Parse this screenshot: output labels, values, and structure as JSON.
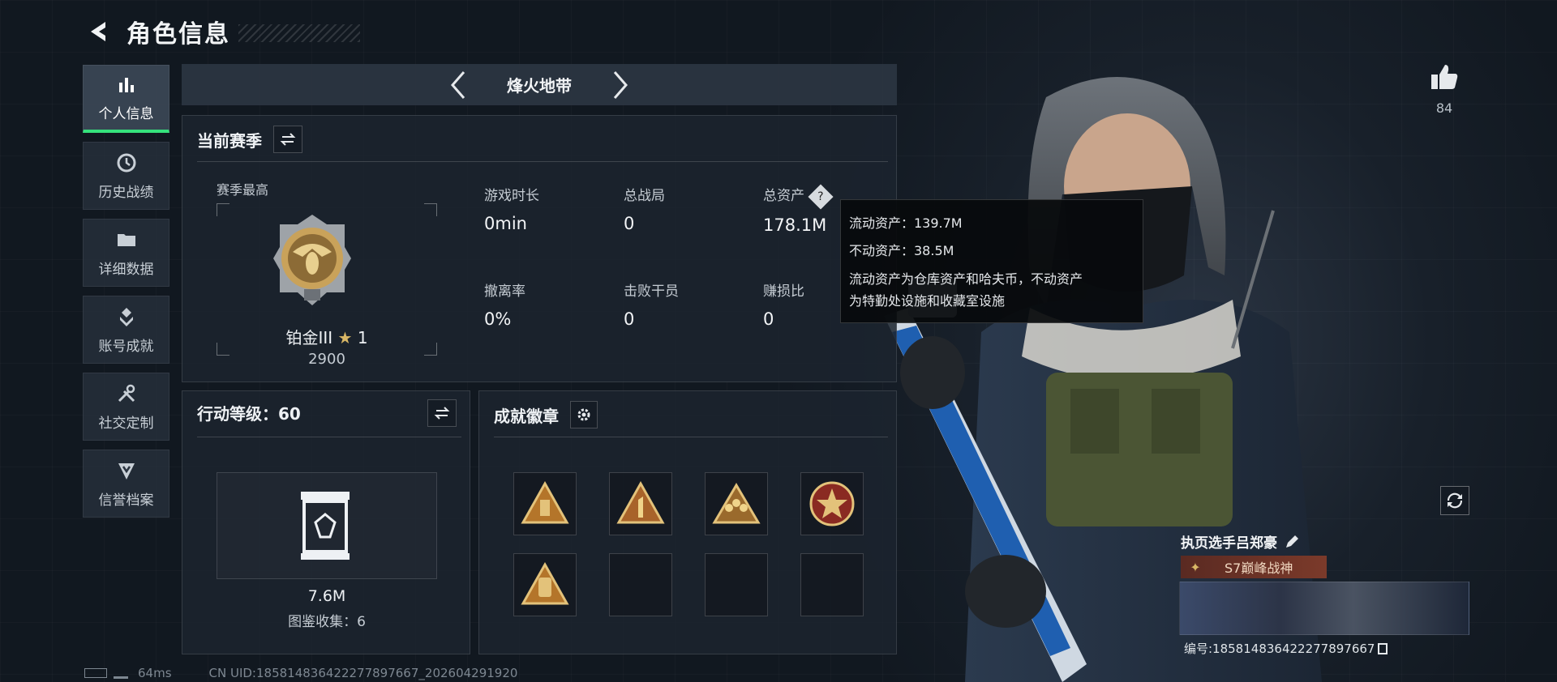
{
  "header": {
    "title": "角色信息"
  },
  "sidebar": {
    "items": [
      {
        "label": "个人信息",
        "icon": "bar-chart-icon",
        "active": true
      },
      {
        "label": "历史战绩",
        "icon": "clock-icon"
      },
      {
        "label": "详细数据",
        "icon": "folder-icon"
      },
      {
        "label": "账号成就",
        "icon": "achievement-icon"
      },
      {
        "label": "社交定制",
        "icon": "tools-icon"
      },
      {
        "label": "信誉档案",
        "icon": "shield-icon"
      }
    ]
  },
  "mode": {
    "title": "烽火地带"
  },
  "season": {
    "title": "当前赛季",
    "best_label": "赛季最高",
    "rank_name": "铂金III",
    "rank_stars": "1",
    "rank_score": "2900",
    "stats": [
      {
        "label": "游戏时长",
        "value": "0min"
      },
      {
        "label": "总战局",
        "value": "0"
      },
      {
        "label": "总资产",
        "value": "178.1M"
      },
      {
        "label": "撤离率",
        "value": "0%"
      },
      {
        "label": "击败干员",
        "value": "0"
      },
      {
        "label": "赚损比",
        "value": "0"
      }
    ]
  },
  "tooltip": {
    "liquid": "流动资产：139.7M",
    "fixed": "不动资产：38.5M",
    "note_line1": "流动资产为仓库资产和哈夫币，不动资产",
    "note_line2": "为特勤处设施和收藏室设施"
  },
  "action_level": {
    "title": "行动等级：60",
    "value": "7.6M",
    "collection": "图鉴收集：6"
  },
  "badges": {
    "title": "成就徽章"
  },
  "like": {
    "count": "84"
  },
  "player": {
    "name": "执页选手吕郑豪",
    "tag": "S7巅峰战神",
    "id_text": "编号:1858148364222778976​67"
  },
  "footer": {
    "ping": "64ms",
    "uid": "CN UID:1858148364222778976​67_202604291920"
  },
  "colors": {
    "accent": "#35e27c",
    "gold": "#c9a25a"
  }
}
